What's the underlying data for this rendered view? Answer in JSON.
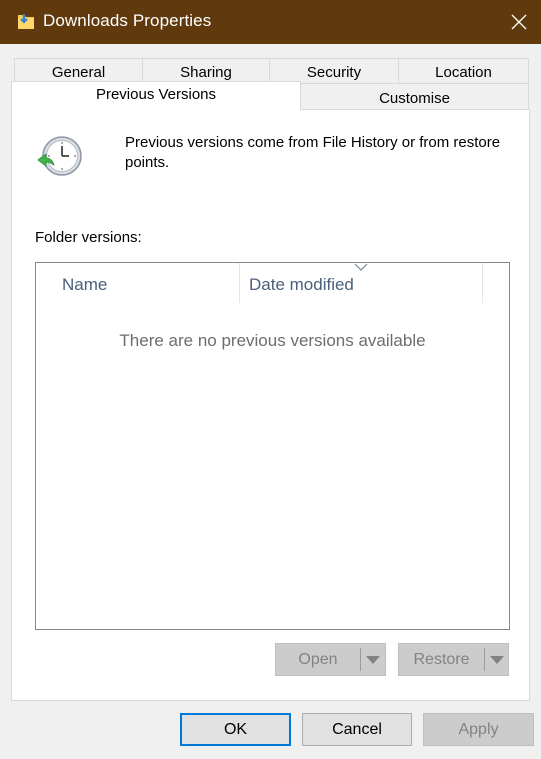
{
  "window": {
    "title": "Downloads Properties",
    "icon": "folder-download-icon",
    "close_icon": "close-icon",
    "accent_color": "#603a0d"
  },
  "tabs": {
    "row1": [
      "General",
      "Sharing",
      "Security",
      "Location"
    ],
    "row2": [
      "Previous Versions",
      "Customise"
    ],
    "active": "Previous Versions"
  },
  "panel": {
    "info_icon": "clock-restore-icon",
    "info_text": "Previous versions come from File History or from restore points.",
    "folder_versions_label": "Folder versions:",
    "list": {
      "columns": [
        "Name",
        "Date modified"
      ],
      "sorted_column": "Date modified",
      "empty_message": "There are no previous versions available",
      "rows": []
    },
    "buttons": {
      "open": "Open",
      "restore": "Restore"
    }
  },
  "footer": {
    "ok": "OK",
    "cancel": "Cancel",
    "apply": "Apply"
  }
}
